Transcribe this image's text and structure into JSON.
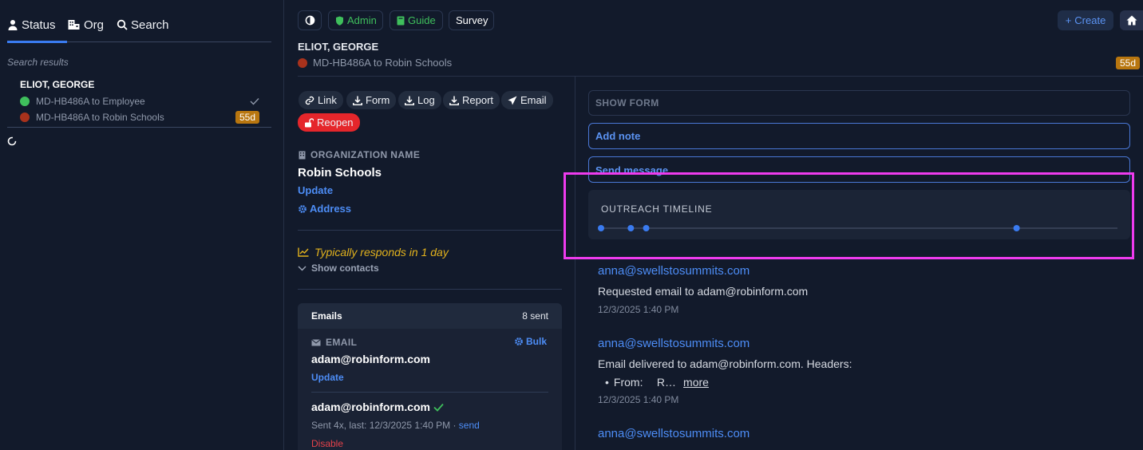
{
  "sidebar": {
    "tabs": [
      {
        "label": "Status",
        "icon": "person-icon"
      },
      {
        "label": "Org",
        "icon": "building-icon"
      },
      {
        "label": "Search",
        "icon": "search-icon"
      }
    ],
    "results_label": "Search results",
    "result": {
      "name": "ELIOT, GEORGE",
      "items": [
        {
          "label": "MD-HB486A to Employee",
          "status_color": "#3fbf5c",
          "trailing": "check"
        },
        {
          "label": "MD-HB486A to Robin Schools",
          "status_color": "#a8321c",
          "badge": "55d"
        }
      ]
    }
  },
  "topbar": {
    "admin": "Admin",
    "guide": "Guide",
    "survey": "Survey",
    "create": "Create"
  },
  "header": {
    "name": "ELIOT, GEORGE",
    "subtitle": "MD-HB486A to Robin Schools",
    "badge": "55d"
  },
  "actions": {
    "link": "Link",
    "form": "Form",
    "log": "Log",
    "report": "Report",
    "email": "Email",
    "reopen": "Reopen"
  },
  "org": {
    "section_label": "ORGANIZATION NAME",
    "name": "Robin Schools",
    "update": "Update",
    "address": "Address",
    "responds": "Typically responds in 1 day",
    "show_contacts": "Show contacts"
  },
  "emails": {
    "title": "Emails",
    "count": "8 sent",
    "section_label": "EMAIL",
    "bulk": "Bulk",
    "primary": "adam@robinform.com",
    "update": "Update",
    "entry_address": "adam@robinform.com",
    "entry_meta": "Sent 4x, last: 12/3/2025 1:40 PM · ",
    "entry_send": "send",
    "disable": "Disable"
  },
  "right": {
    "show_form": "SHOW FORM",
    "add_note": "Add note",
    "send_message": "Send message",
    "timeline_title": "OUTREACH TIMELINE",
    "timeline_points": [
      0.0,
      0.064,
      0.097,
      0.893
    ]
  },
  "feed": [
    {
      "from": "anna@swellstosummits.com",
      "text": "Requested email to adam@robinform.com",
      "time": "12/3/2025 1:40 PM"
    },
    {
      "from": "anna@swellstosummits.com",
      "text": "Email delivered to adam@robinform.com. Headers:",
      "bullet_label": "From:",
      "bullet_value": "R…",
      "more": "more",
      "time": "12/3/2025 1:40 PM"
    },
    {
      "from": "anna@swellstosummits.com"
    }
  ],
  "colors": {
    "accent": "#3a7bf0",
    "highlight": "#ee3bee",
    "reopen": "#e5262b",
    "warning_text": "#e2b21d"
  }
}
